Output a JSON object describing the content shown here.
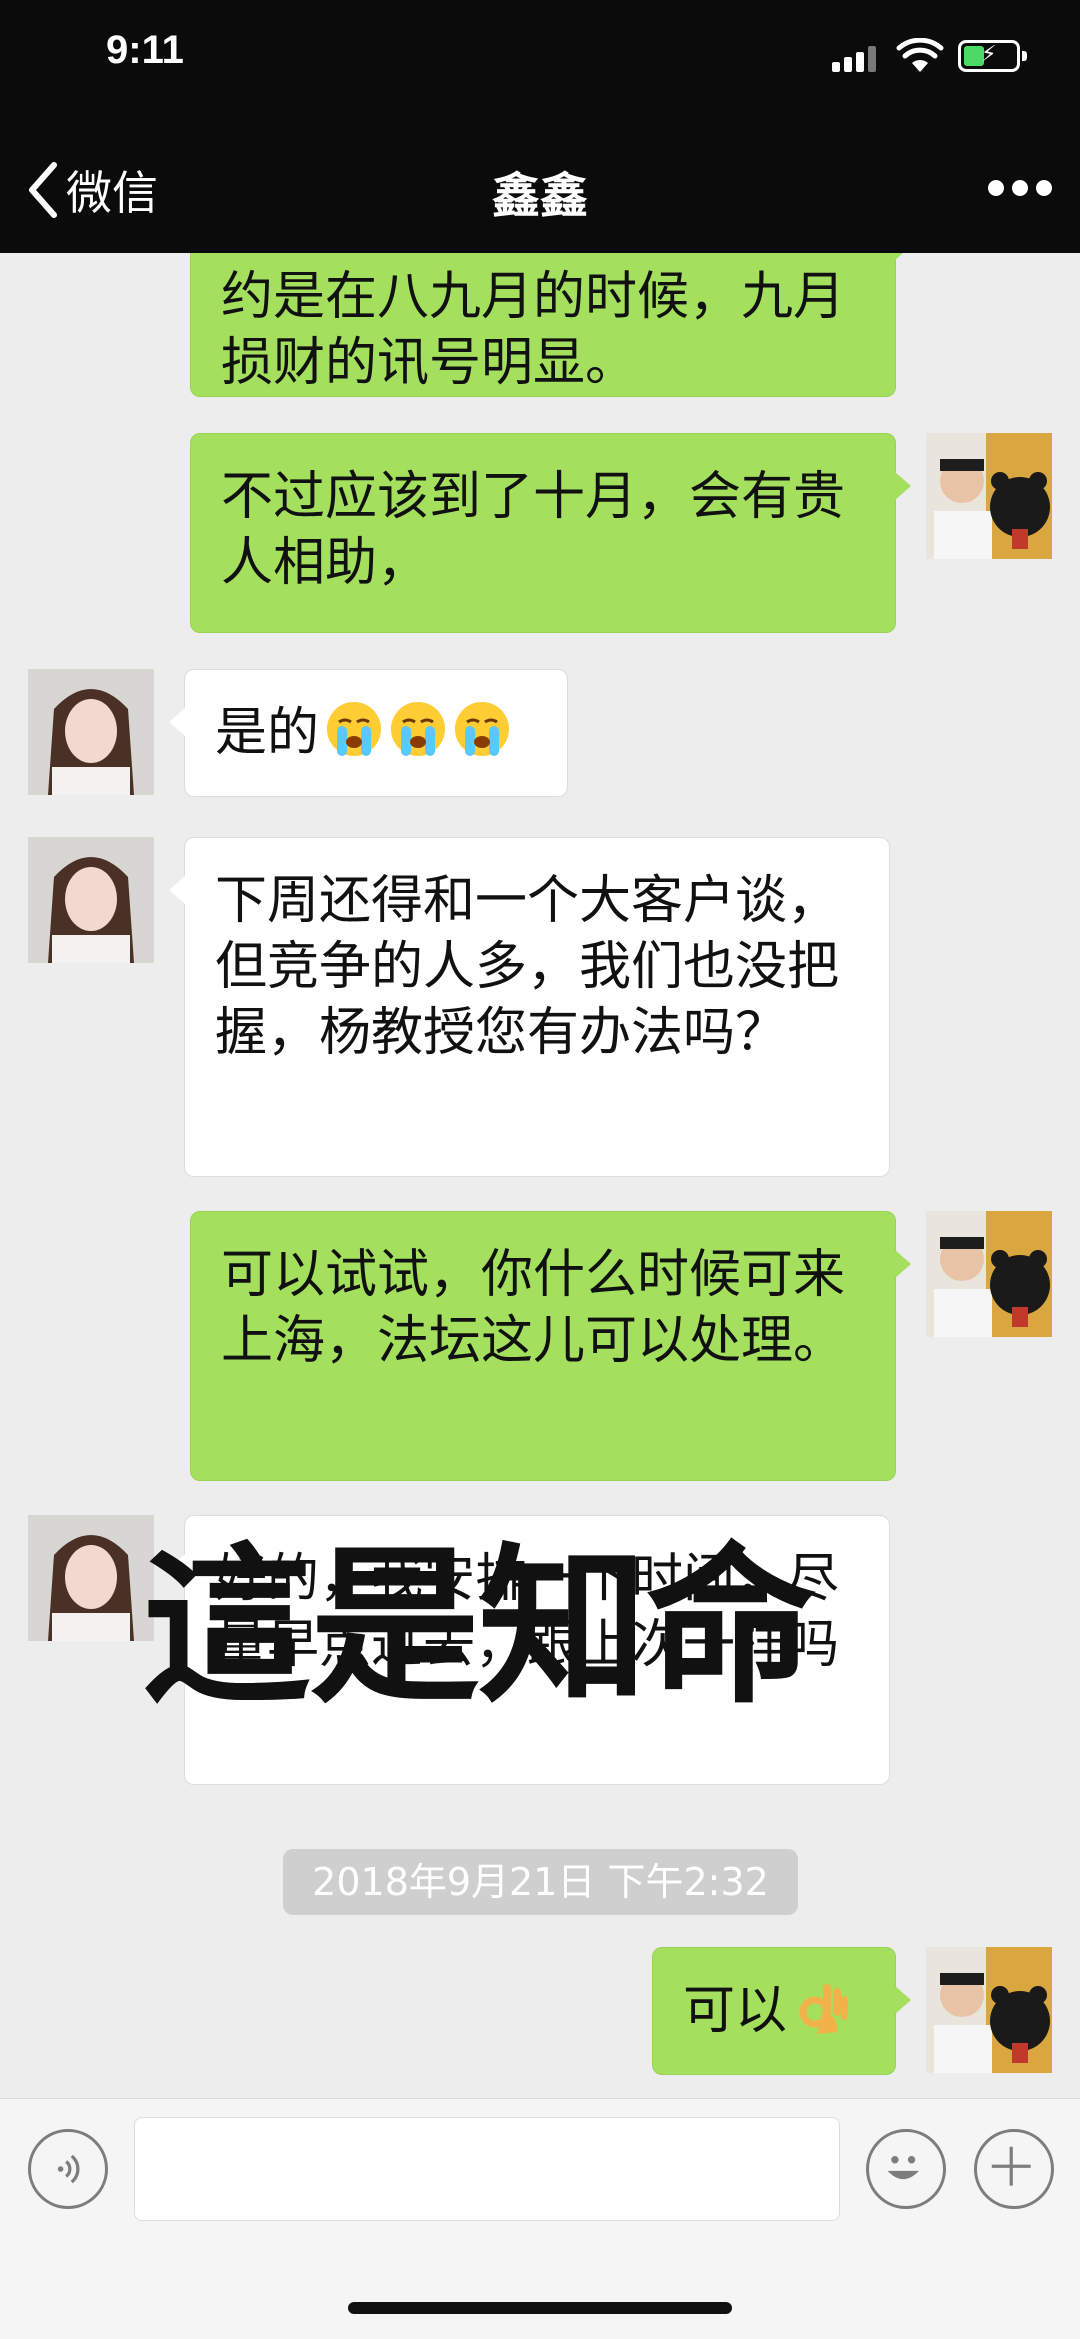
{
  "status_bar": {
    "time": "9:11"
  },
  "nav": {
    "back_label": "微信",
    "title": "鑫鑫"
  },
  "messages": [
    {
      "side": "right",
      "text": "约是在八九月的时候，九月损财的讯号明显。"
    },
    {
      "side": "right",
      "text": "不过应该到了十月，会有贵人相助，"
    },
    {
      "side": "left",
      "text": "是的"
    },
    {
      "side": "left",
      "text": "下周还得和一个大客户谈，但竞争的人多，我们也没把握，杨教授您有办法吗？"
    },
    {
      "side": "right",
      "text": "可以试试，你什么时候可来上海，法坛这儿可以处理。"
    },
    {
      "side": "left",
      "text": "好的，我安排一下时间，尽量早点过去，跟上次一样吗"
    },
    {
      "side": "right",
      "text": "可以"
    }
  ],
  "timestamp": "2018年9月21日 下午2:32",
  "overlay_text": "這是知命",
  "icons": {
    "emoji_crying": "crying-face-emoji",
    "emoji_ok": "ok-hand-emoji",
    "voice": "voice-icon",
    "emoji_button": "smiley-icon",
    "plus": "plus-icon"
  },
  "colors": {
    "sent_bubble": "#a4e05e",
    "received_bubble": "#ffffff",
    "nav_bg": "#0b0b0b",
    "chat_bg": "#ededed"
  }
}
